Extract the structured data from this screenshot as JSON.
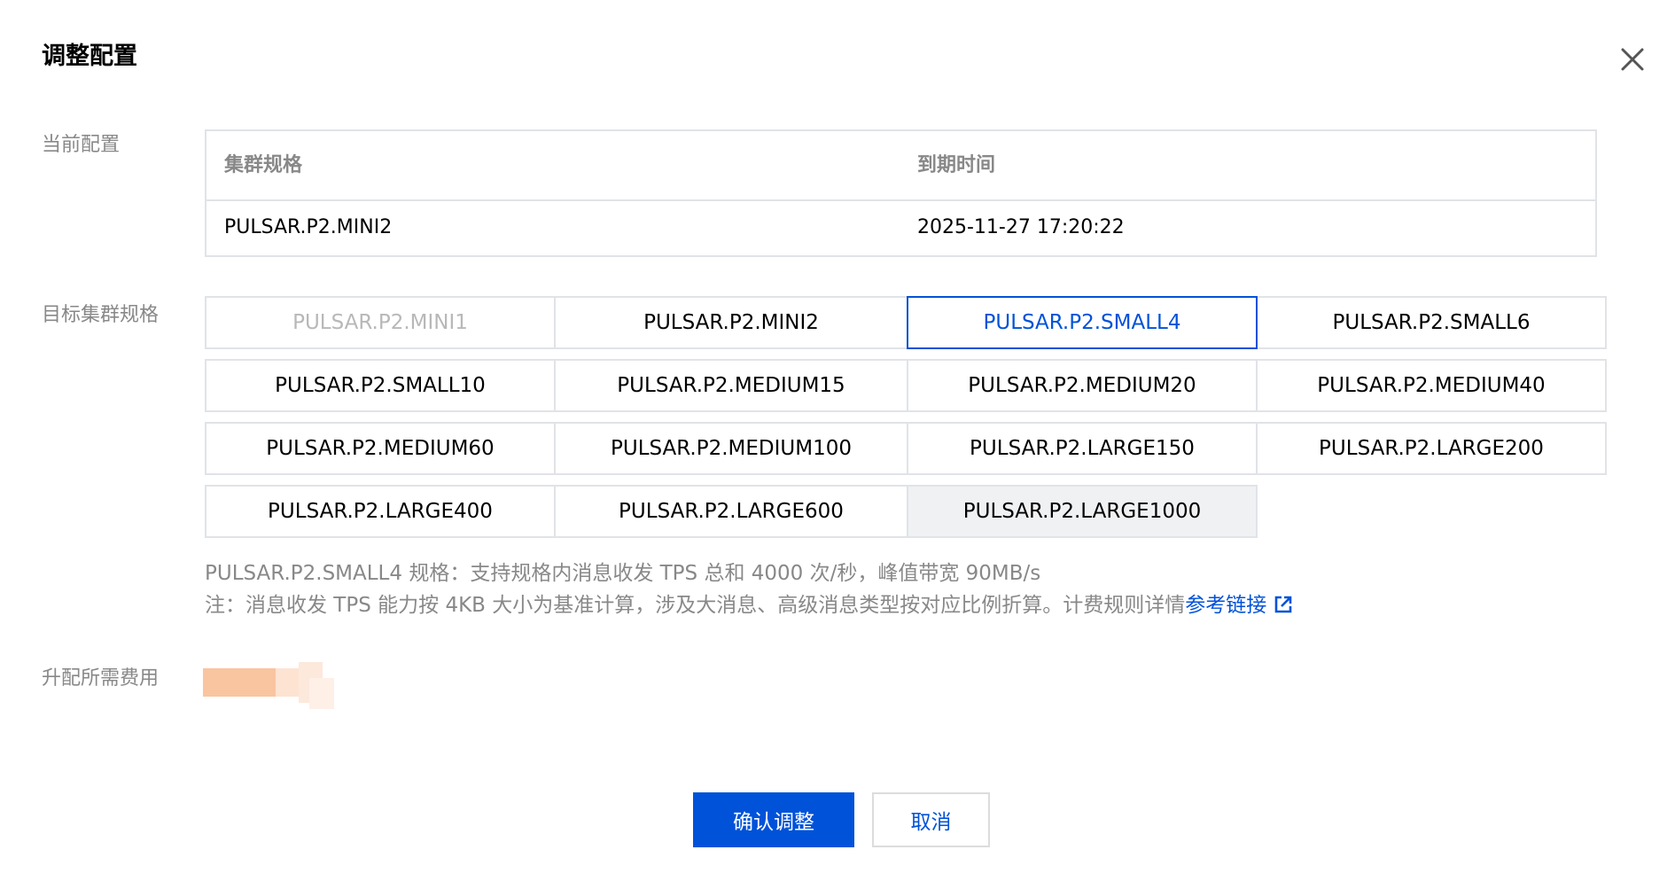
{
  "dialog": {
    "title": "调整配置"
  },
  "current": {
    "label": "当前配置",
    "headers": [
      "集群规格",
      "到期时间"
    ],
    "row": [
      "PULSAR.P2.MINI2",
      "2025-11-27 17:20:22"
    ]
  },
  "target": {
    "label": "目标集群规格",
    "selected": "PULSAR.P2.SMALL4",
    "options": [
      "PULSAR.P2.MINI1",
      "PULSAR.P2.MINI2",
      "PULSAR.P2.SMALL4",
      "PULSAR.P2.SMALL6",
      "PULSAR.P2.SMALL10",
      "PULSAR.P2.MEDIUM15",
      "PULSAR.P2.MEDIUM20",
      "PULSAR.P2.MEDIUM40",
      "PULSAR.P2.MEDIUM60",
      "PULSAR.P2.MEDIUM100",
      "PULSAR.P2.LARGE150",
      "PULSAR.P2.LARGE200",
      "PULSAR.P2.LARGE400",
      "PULSAR.P2.LARGE600",
      "PULSAR.P2.LARGE1000"
    ],
    "disabled": [
      "PULSAR.P2.MINI1"
    ],
    "hovered": "PULSAR.P2.LARGE1000",
    "spec_desc": "PULSAR.P2.SMALL4 规格：支持规格内消息收发 TPS 总和 4000 次/秒，峰值带宽 90MB/s",
    "note": "注：消息收发 TPS 能力按 4KB 大小为基准计算，涉及大消息、高级消息类型按对应比例折算。计费规则详情",
    "link_text": "参考链接",
    "link_icon": "external-link-icon"
  },
  "upgrade": {
    "label": "升配所需费用"
  },
  "buttons": {
    "confirm": "确认调整",
    "cancel": "取消"
  },
  "colors": {
    "accent": "#0052d9",
    "border": "#e0e3e8",
    "muted_text": "#888888",
    "price_blur": "#f9c9a8"
  }
}
